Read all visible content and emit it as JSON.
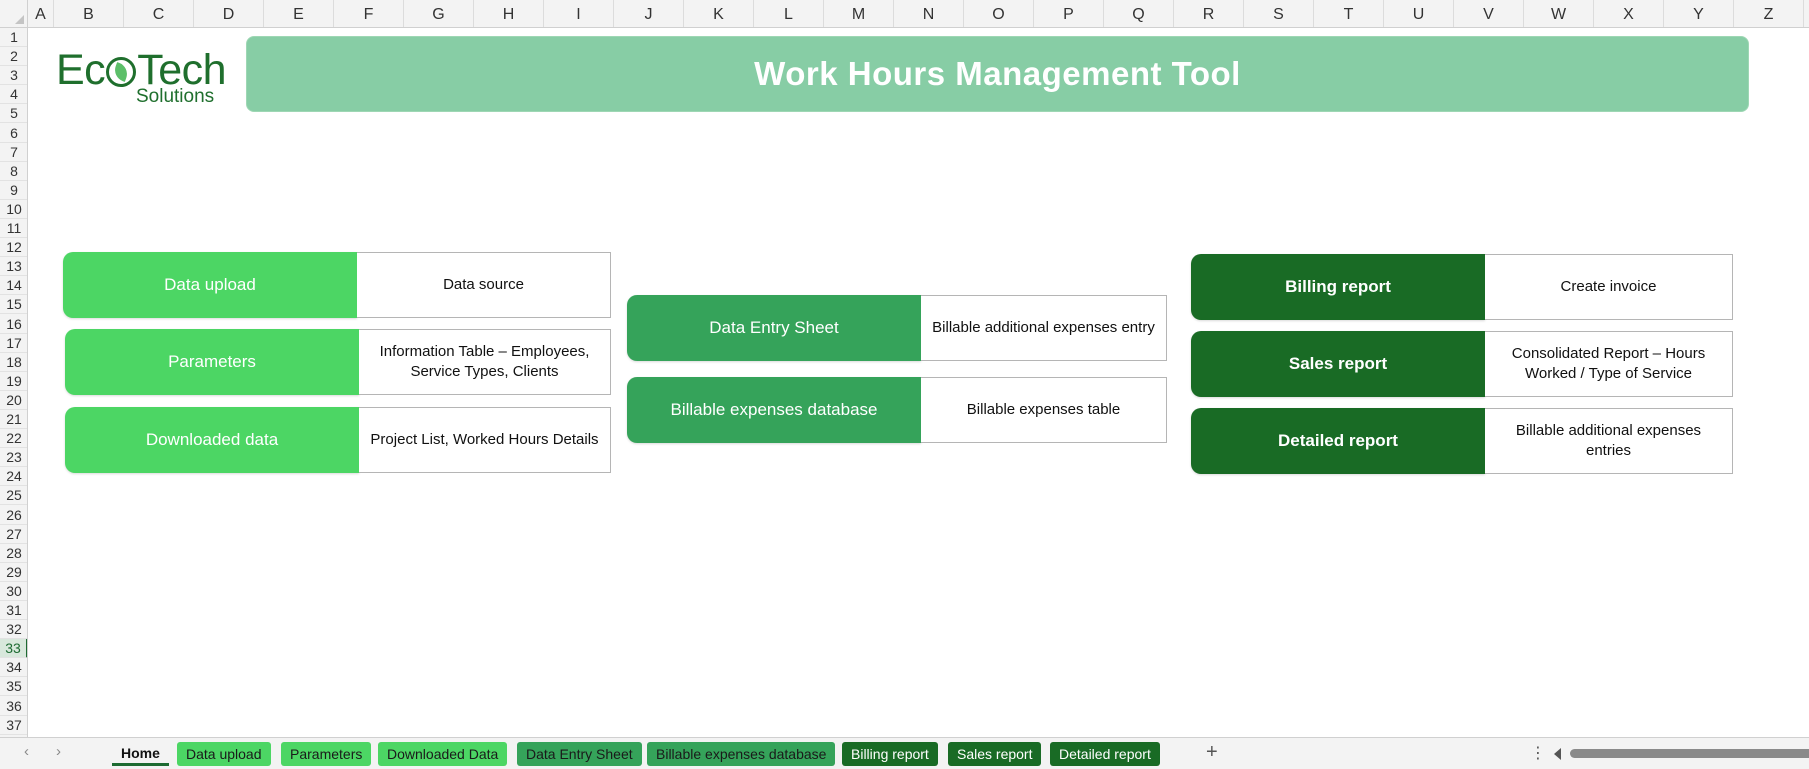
{
  "columns": [
    "A",
    "B",
    "C",
    "D",
    "E",
    "F",
    "G",
    "H",
    "I",
    "J",
    "K",
    "L",
    "M",
    "N",
    "O",
    "P",
    "Q",
    "R",
    "S",
    "T",
    "U",
    "V",
    "W",
    "X",
    "Y",
    "Z"
  ],
  "rows": [
    "1",
    "2",
    "3",
    "4",
    "5",
    "6",
    "7",
    "8",
    "9",
    "10",
    "11",
    "12",
    "13",
    "14",
    "15",
    "16",
    "17",
    "18",
    "19",
    "20",
    "21",
    "22",
    "23",
    "24",
    "25",
    "26",
    "27",
    "28",
    "29",
    "30",
    "31",
    "32",
    "33",
    "34",
    "35",
    "36",
    "37"
  ],
  "selected_row": "33",
  "logo": {
    "name": "EcoTech",
    "name_prefix": "Ec",
    "name_suffix": "Tech",
    "subtitle": "Solutions"
  },
  "title": "Work Hours Management Tool",
  "groups": [
    {
      "cards": [
        {
          "button": "Data upload",
          "description": "Data source"
        },
        {
          "button": "Parameters",
          "description": "Information Table – Employees, Service Types, Clients"
        },
        {
          "button": "Downloaded data",
          "description": "Project List, Worked Hours Details"
        }
      ]
    },
    {
      "cards": [
        {
          "button": "Data Entry Sheet",
          "description": "Billable additional expenses entry"
        },
        {
          "button": "Billable expenses database",
          "description": "Billable expenses table"
        }
      ]
    },
    {
      "cards": [
        {
          "button": "Billing report",
          "description": "Create invoice"
        },
        {
          "button": "Sales report",
          "description": "Consolidated Report – Hours Worked / Type of Service"
        },
        {
          "button": "Detailed report",
          "description": "Billable additional expenses entries"
        }
      ]
    }
  ],
  "sheet_tabs": [
    {
      "label": "Home",
      "active": true
    },
    {
      "label": "Data upload"
    },
    {
      "label": "Parameters"
    },
    {
      "label": "Downloaded Data"
    },
    {
      "label": "Data Entry Sheet"
    },
    {
      "label": "Billable expenses database"
    },
    {
      "label": "Billing report"
    },
    {
      "label": "Sales report"
    },
    {
      "label": "Detailed report"
    }
  ],
  "icons": {
    "prev": "chevron-left-icon",
    "next": "chevron-right-icon",
    "add": "plus-icon",
    "more": "more-vertical-icon"
  },
  "colors": {
    "banner": "#87cda5",
    "group1": "#4cd664",
    "group2": "#35a35a",
    "group3": "#196b25",
    "logo": "#1f6f2d"
  }
}
